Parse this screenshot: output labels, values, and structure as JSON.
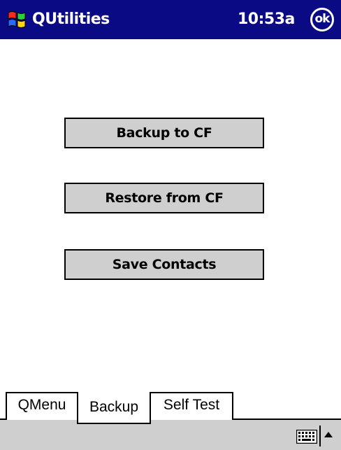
{
  "title_bar": {
    "app_title": "QUtilities",
    "time": "10:53a",
    "ok_label": "ok",
    "start_icon": "windows-flag-icon",
    "background_color": "#0a0a84"
  },
  "actions": {
    "backup_label": "Backup to CF",
    "restore_label": "Restore from CF",
    "save_label": "Save Contacts"
  },
  "tabs": [
    {
      "label": "QMenu",
      "selected": false
    },
    {
      "label": "Backup",
      "selected": true
    },
    {
      "label": "Self Test",
      "selected": false
    }
  ],
  "command_bar": {
    "input_panel_icon": "keyboard-icon",
    "input_arrow_icon": "up-arrow-icon",
    "background_color": "#cfcfcf"
  }
}
